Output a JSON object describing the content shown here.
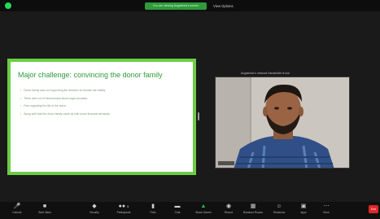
{
  "top_bar": {
    "share_banner": "You are viewing Angatimar's screen",
    "view_options": "View Options"
  },
  "slide": {
    "title": "Major challenge: convincing the donor family",
    "bullets": [
      "Donor family was not supporting the decision on donate hat initially",
      "There were lot of misconcepts about organ donation",
      "Fear regarding the life of the donor",
      "Along with that the donor family came up with some financial demands"
    ]
  },
  "video": {
    "speaker_label": "Angatimar's network bandwidth is low"
  },
  "toolbar": {
    "items": [
      {
        "label": "Unmute",
        "icon": "microphone-muted-icon"
      },
      {
        "label": "Start Video",
        "icon": "video-camera-off-icon"
      },
      {
        "label": "Security",
        "icon": "shield-icon"
      },
      {
        "label": "Participants",
        "icon": "participants-icon",
        "count": "5"
      },
      {
        "label": "Polls",
        "icon": "polls-icon"
      },
      {
        "label": "Chat",
        "icon": "chat-icon"
      },
      {
        "label": "Share Screen",
        "icon": "share-screen-icon"
      },
      {
        "label": "Record",
        "icon": "record-icon"
      },
      {
        "label": "Breakout Rooms",
        "icon": "breakout-rooms-icon"
      },
      {
        "label": "Reactions",
        "icon": "reactions-icon"
      },
      {
        "label": "Apps",
        "icon": "apps-icon"
      },
      {
        "label": "More",
        "icon": "more-icon"
      }
    ],
    "end_label": "End"
  },
  "colors": {
    "accent_green": "#2fb84b",
    "slide_border": "#6ccd44",
    "slide_title": "#2e9b3c",
    "end_red": "#e02828"
  }
}
